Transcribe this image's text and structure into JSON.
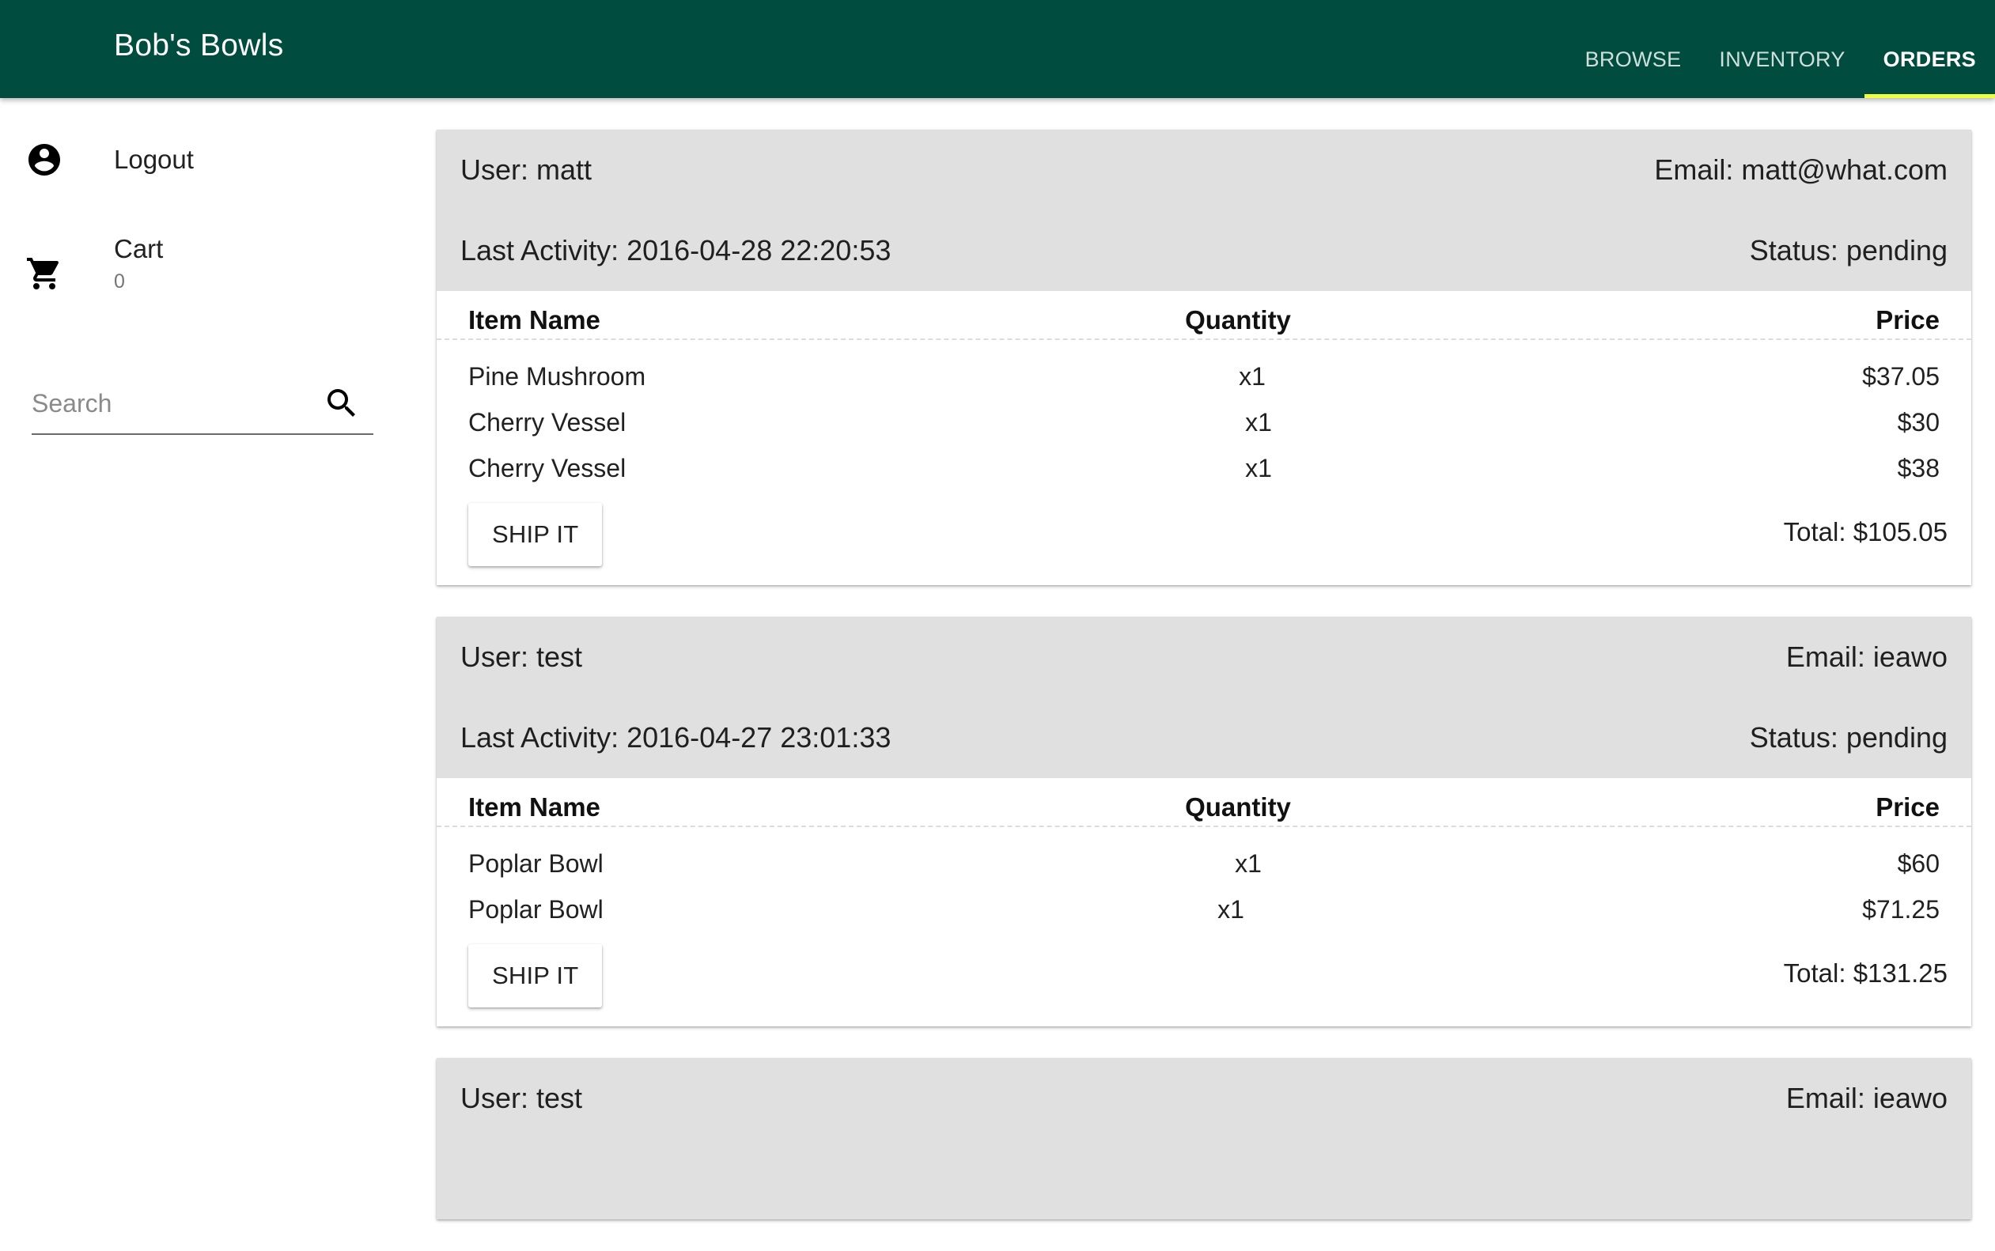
{
  "app": {
    "title": "Bob's Bowls"
  },
  "nav": {
    "tabs": [
      {
        "label": "BROWSE",
        "active": false
      },
      {
        "label": "INVENTORY",
        "active": false
      },
      {
        "label": "ORDERS",
        "active": true
      }
    ]
  },
  "sidebar": {
    "logout": {
      "label": "Logout",
      "icon": "account-circle-icon"
    },
    "cart": {
      "label": "Cart",
      "count": "0",
      "icon": "shopping-cart-icon"
    },
    "search": {
      "placeholder": "Search",
      "value": "",
      "icon": "search-icon"
    }
  },
  "columns": {
    "name": "Item Name",
    "quantity": "Quantity",
    "price": "Price"
  },
  "ship_label": "SHIP IT",
  "orders": [
    {
      "user": "User: matt",
      "email": "Email: matt@what.com",
      "last_activity": "Last Activity: 2016-04-28 22:20:53",
      "status": "Status: pending",
      "items": [
        {
          "name": "Pine Mushroom",
          "qty": "x1",
          "price": "$37.05"
        },
        {
          "name": "Cherry Vessel",
          "qty": "x1",
          "price": "$30"
        },
        {
          "name": "Cherry Vessel",
          "qty": "x1",
          "price": "$38"
        }
      ],
      "total": "Total: $105.05"
    },
    {
      "user": "User: test",
      "email": "Email: ieawo",
      "last_activity": "Last Activity: 2016-04-27 23:01:33",
      "status": "Status: pending",
      "items": [
        {
          "name": "Poplar Bowl",
          "qty": "x1",
          "price": "$60"
        },
        {
          "name": "Poplar Bowl",
          "qty": "x1",
          "price": "$71.25"
        }
      ],
      "total": "Total: $131.25"
    },
    {
      "user": "User: test",
      "email": "Email: ieawo"
    }
  ],
  "colors": {
    "appbar": "#004d40",
    "tab_indicator": "#eeff41",
    "card_header": "#e0e0e0"
  }
}
